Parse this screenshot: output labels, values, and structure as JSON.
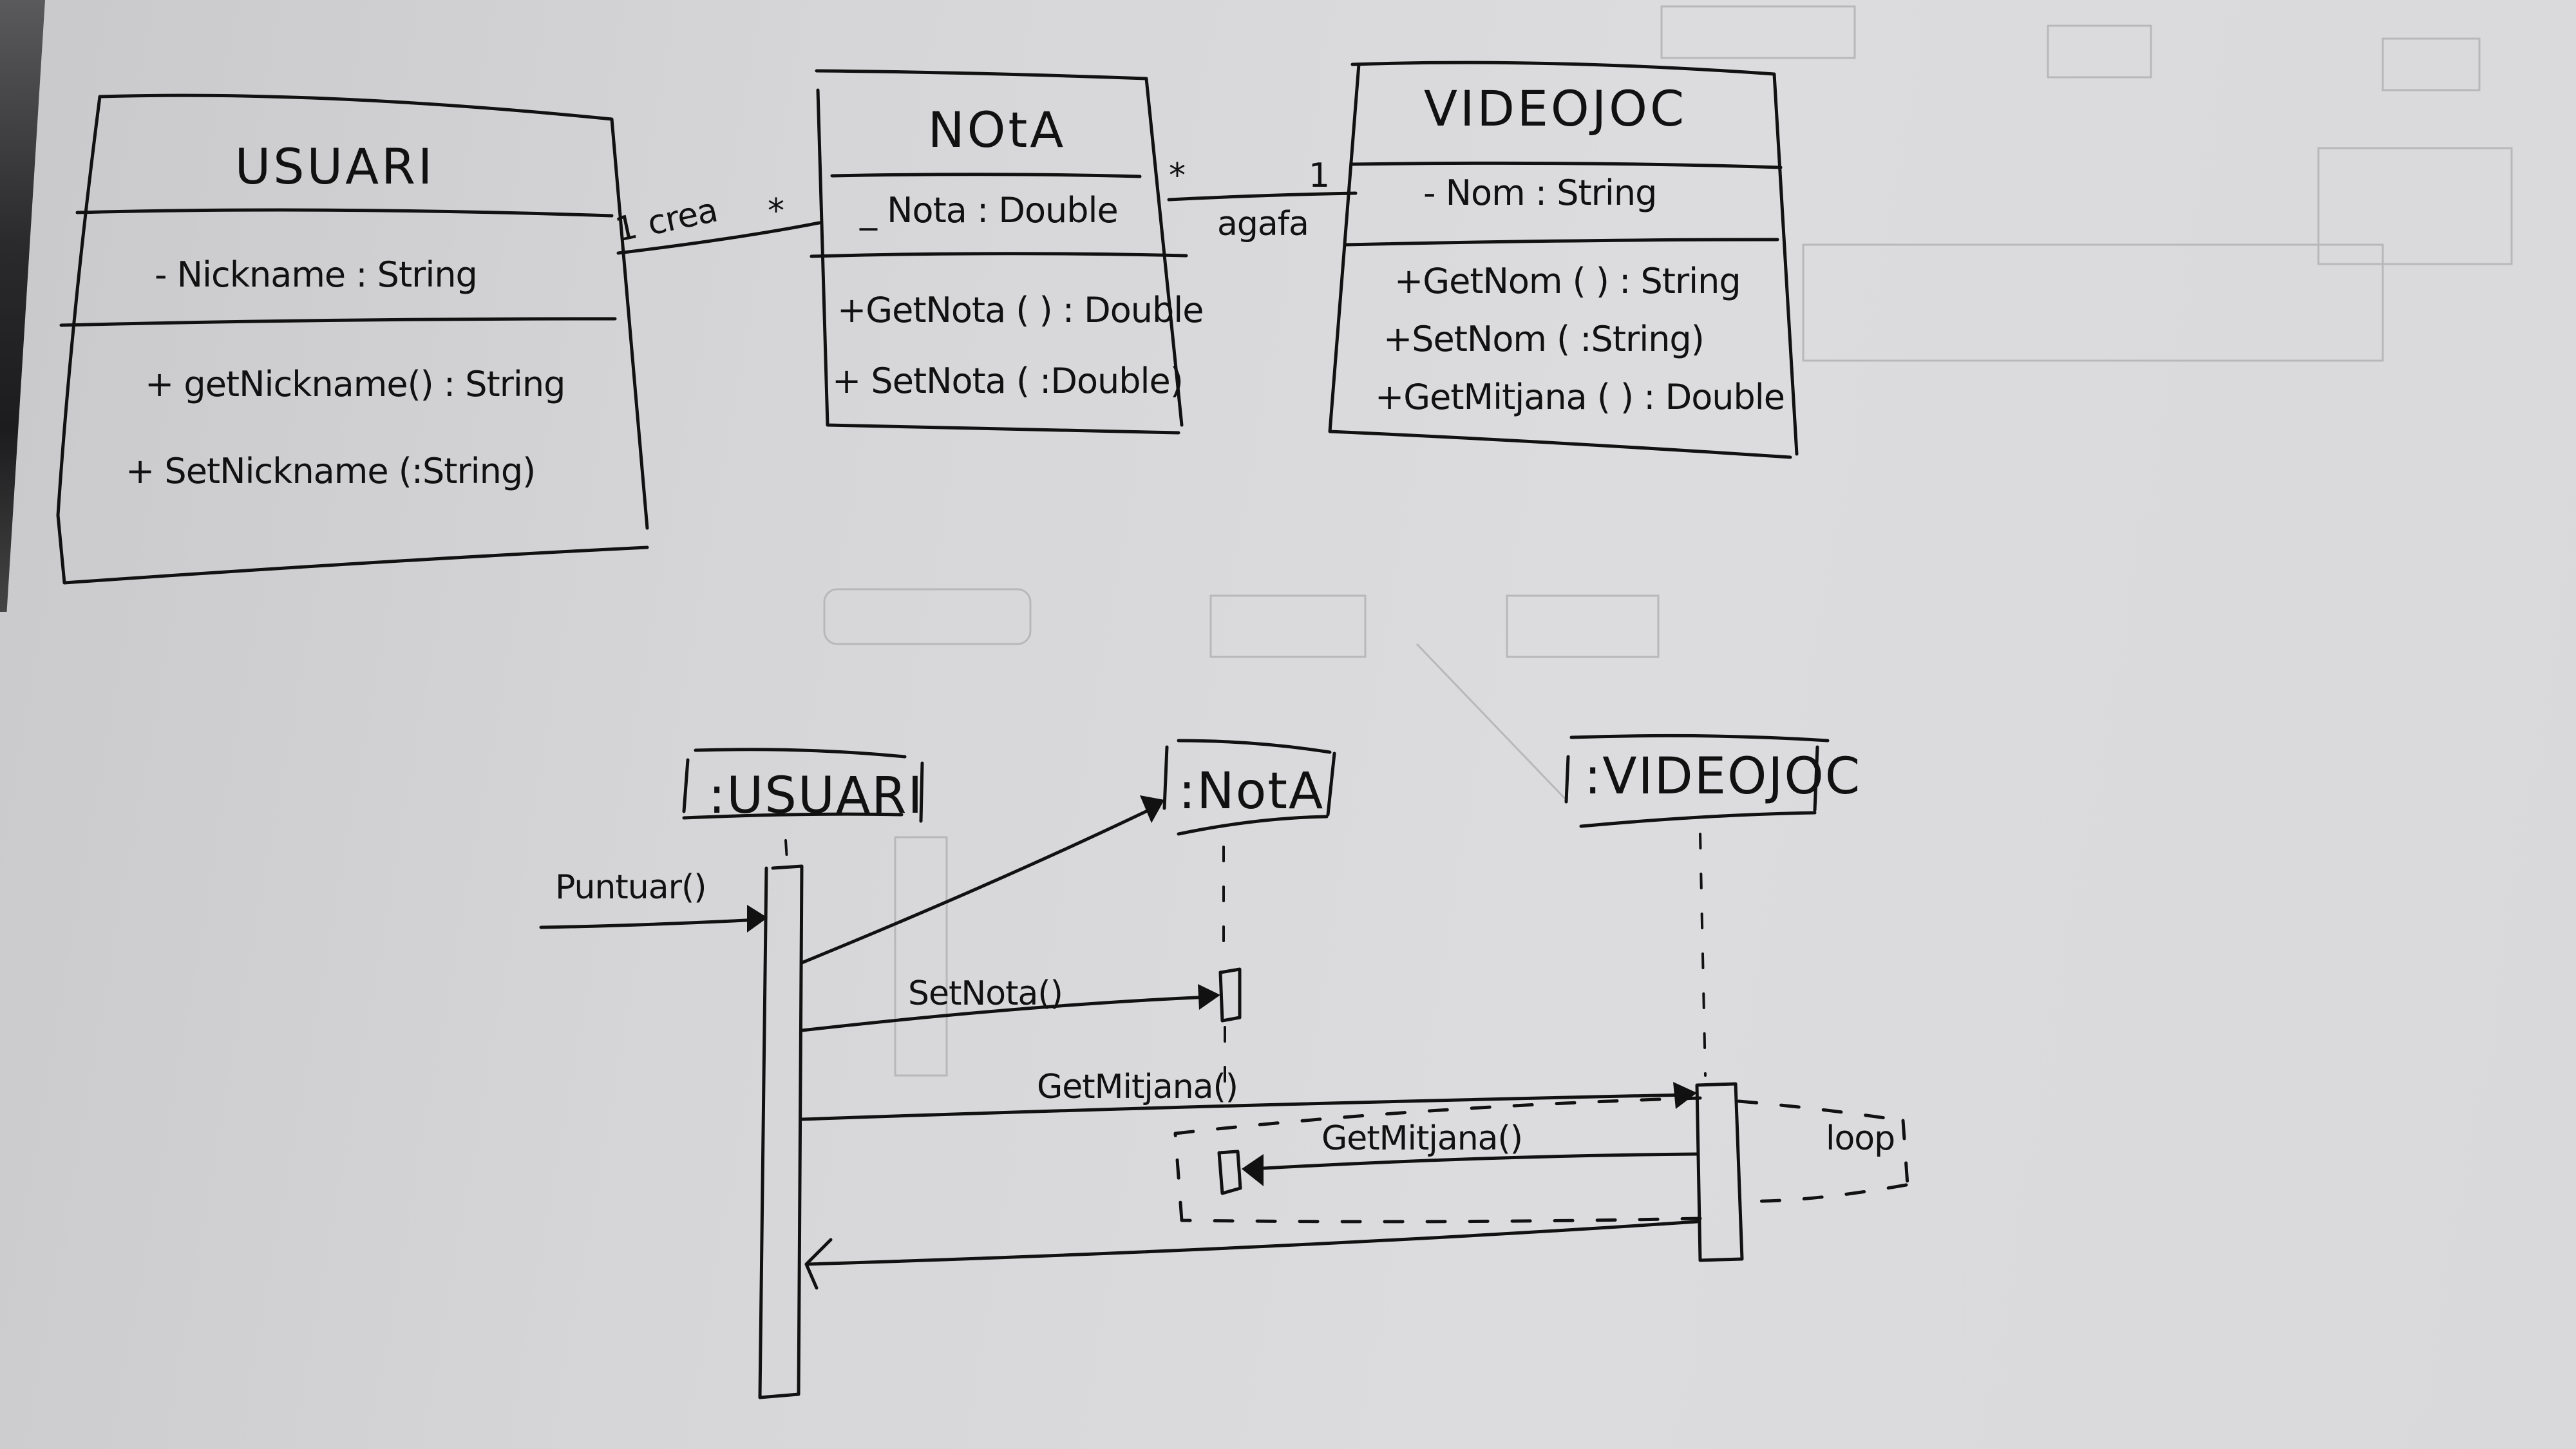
{
  "class_diagram": {
    "classes": [
      {
        "id": "usuari",
        "name": "USUARI",
        "attributes": [
          "- Nickname : String"
        ],
        "methods": [
          "+ getNickname() : String",
          "+ SetNickname (:String)"
        ]
      },
      {
        "id": "nota",
        "name": "NOtA",
        "attributes": [
          "_ Nota : Double"
        ],
        "methods": [
          "+GetNota ( ) : Double",
          "+ SetNota ( :Double)"
        ]
      },
      {
        "id": "videojoc",
        "name": "VIDEOJOC",
        "attributes": [
          "- Nom : String"
        ],
        "methods": [
          "+GetNom ( ) : String",
          "+SetNom ( :String)",
          "+GetMitjana ( ) : Double"
        ]
      }
    ],
    "associations": [
      {
        "from": "usuari",
        "to": "nota",
        "label": "crea",
        "from_mult": "1",
        "to_mult": "*"
      },
      {
        "from": "nota",
        "to": "videojoc",
        "label": "agafa",
        "from_mult": "*",
        "to_mult": "1"
      }
    ]
  },
  "sequence_diagram": {
    "objects": [
      {
        "id": "usuari",
        "label": ":USUARI"
      },
      {
        "id": "nota",
        "label": ":NotA"
      },
      {
        "id": "videojoc",
        "label": ":VIDEOJOC"
      }
    ],
    "messages": [
      {
        "label": "Puntuar()",
        "from": "external",
        "to": "usuari"
      },
      {
        "label": "",
        "from": "usuari",
        "to": "nota",
        "kind": "create"
      },
      {
        "label": "SetNota()",
        "from": "usuari",
        "to": "nota"
      },
      {
        "label": "GetMitjana()",
        "from": "usuari",
        "to": "videojoc"
      },
      {
        "label": "GetMitjana()",
        "from": "videojoc",
        "to": "nota"
      },
      {
        "label": "",
        "from": "videojoc",
        "to": "usuari",
        "kind": "return"
      }
    ],
    "fragments": [
      {
        "type": "loop",
        "label": "loop"
      }
    ]
  }
}
